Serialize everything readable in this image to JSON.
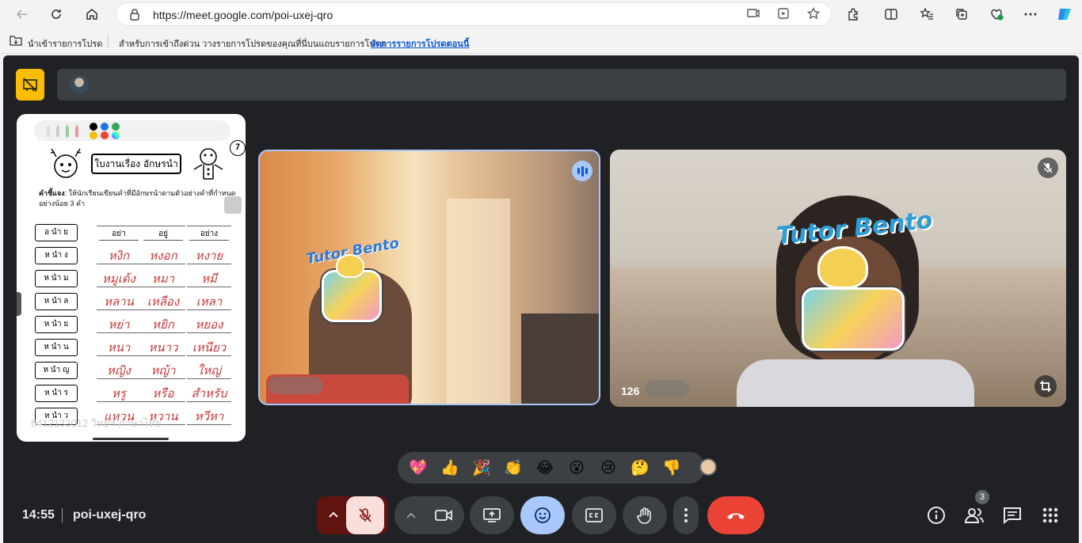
{
  "browser": {
    "url": "https://meet.google.com/poi-uxej-qro",
    "icons": [
      "back-icon",
      "refresh-icon",
      "home-icon",
      "lock-icon",
      "screen-cast-icon",
      "reading-view-icon",
      "star-icon",
      "extensions-icon",
      "split-screen-icon",
      "favorites-icon",
      "collections-icon",
      "browser-essentials-icon",
      "more-icon",
      "copilot-icon"
    ]
  },
  "favorites_bar": {
    "import_label": "นำเข้ารายการโปรด",
    "hint_text": "สำหรับการเข้าถึงด่วน วางรายการโปรดของคุณที่นี่บนแถบรายการโปรด",
    "manage_link": "จัดการรายการโปรดตอนนี้"
  },
  "share_tile": {
    "worksheet_title": "ใบงานเรื่อง อักษรนำ",
    "instruction_label": "คำชี้แจง",
    "instruction_text": ": ให้นักเรียนเขียนคำที่มีอักษรนำตามตัวอย่างคำที่กำหนดอย่างน้อย 3 คำ",
    "corner_number": "7",
    "column_headers": [
      "อย่า",
      "อยู่",
      "อย่าง"
    ],
    "rows": [
      {
        "label": "อ นำ ย",
        "answers": [
          "",
          "",
          ""
        ]
      },
      {
        "label": "ห นำ ง",
        "answers": [
          "หงิก",
          "หงอก",
          "หงาย"
        ]
      },
      {
        "label": "ห นำ ม",
        "answers": [
          "หมูเด้ง",
          "หมา",
          "หมี"
        ]
      },
      {
        "label": "ห นำ ล",
        "answers": [
          "หลาน",
          "เหลือง",
          "เหลา"
        ]
      },
      {
        "label": "ห นำ ย",
        "answers": [
          "หย่า",
          "หยิก",
          "หยอง"
        ]
      },
      {
        "label": "ห นำ น",
        "answers": [
          "หนา",
          "หนาว",
          "เหนียว"
        ]
      },
      {
        "label": "ห นำ ญ",
        "answers": [
          "หญิง",
          "หญ้า",
          "ใหญ่"
        ]
      },
      {
        "label": "ห นำ ร",
        "answers": [
          "หรู",
          "หรือ",
          "สำหรับ"
        ]
      },
      {
        "label": "ห นำ ว",
        "answers": [
          "แหวน",
          "หวาน",
          "หวีหา"
        ]
      }
    ],
    "footer": "6412133012 วิทย์ฯ ภาษาไทย"
  },
  "participants": [
    {
      "name": "",
      "speaking": true,
      "sticker": "Tutor Bento"
    },
    {
      "name": "126",
      "muted": true,
      "sticker": "Tutor Bento"
    }
  ],
  "reactions": [
    "💖",
    "👍",
    "🎉",
    "👏",
    "😂",
    "😮",
    "😢",
    "🤔",
    "👎"
  ],
  "meeting": {
    "time": "14:55",
    "code": "poi-uxej-qro",
    "participant_count": "3"
  },
  "colors": {
    "meet_bg": "#202124",
    "control_grey": "#3c4043",
    "end_call_red": "#ea4335",
    "mic_off_bg": "#f9dedc",
    "active_blue": "#a8c7fa",
    "accent_yellow": "#fbbc04"
  }
}
